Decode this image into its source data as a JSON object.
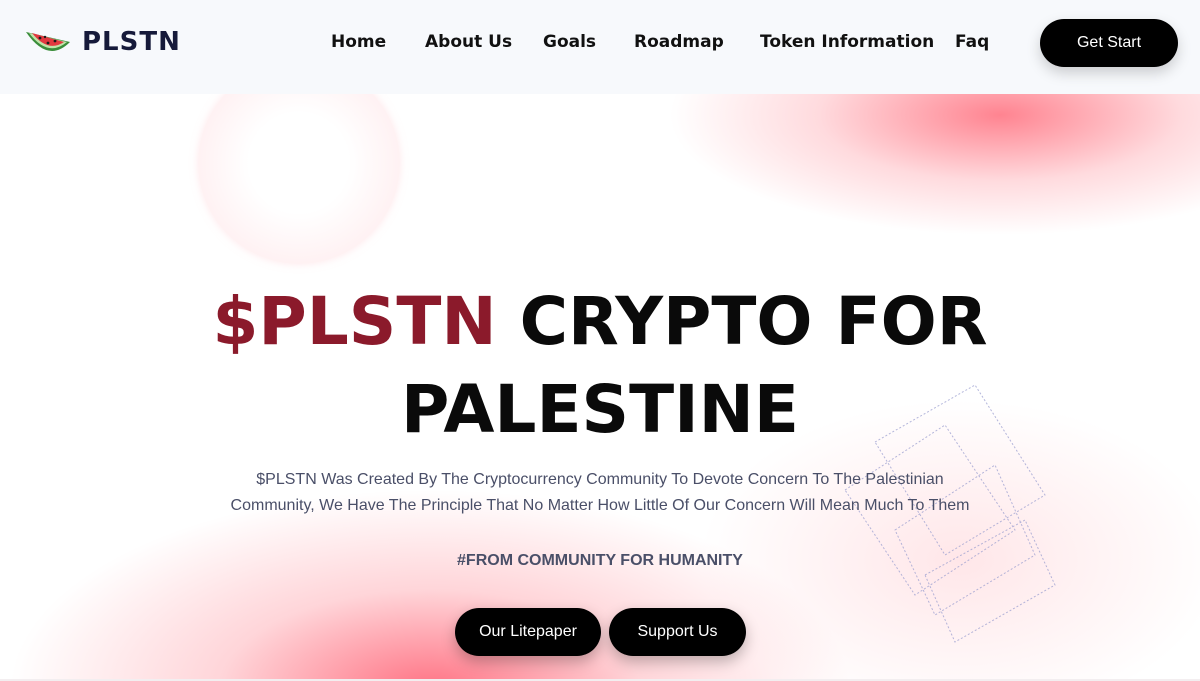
{
  "brand": {
    "name": "PLSTN",
    "logo_icon": "watermelon-slice-icon"
  },
  "nav": {
    "items": [
      {
        "label": "Home"
      },
      {
        "label": "About Us"
      },
      {
        "label": "Goals"
      },
      {
        "label": "Roadmap"
      },
      {
        "label": "Token Information"
      },
      {
        "label": "Faq"
      }
    ],
    "cta_label": "Get Start"
  },
  "hero": {
    "title_accent": "$PLSTN",
    "title_rest": "CRYPTO FOR",
    "title_line2": "PALESTINE",
    "description_line1": "$PLSTN Was Created By The Cryptocurrency Community To Devote Concern To The Palestinian",
    "description_line2": "Community, We Have The Principle That No Matter How Little Of Our Concern Will Mean Much To Them",
    "tagline": "#FROM COMMUNITY FOR HUMANITY",
    "buttons": [
      {
        "label": "Our Litepaper"
      },
      {
        "label": "Support Us"
      }
    ]
  },
  "colors": {
    "accent": "#8b1a2b",
    "button_bg": "#000000",
    "text_dark": "#0a0a0a",
    "text_muted": "#4a4f68",
    "glow": "#ff6e7d"
  }
}
